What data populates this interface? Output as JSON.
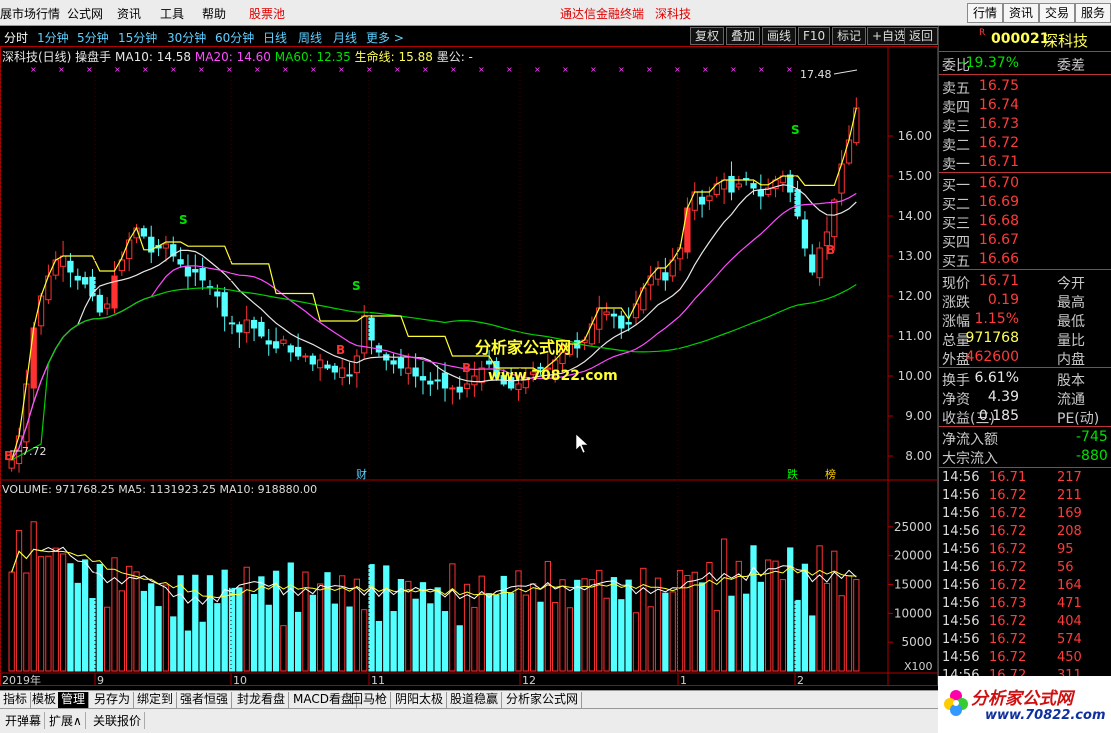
{
  "menu": {
    "items": [
      "展市场行情",
      "公式网",
      "资讯",
      "工具",
      "帮助"
    ],
    "stock_pool": "股票池",
    "title_center": "通达信金融终端",
    "title_stock": "深科技",
    "right_buttons": [
      "行情",
      "资讯",
      "交易",
      "服务"
    ]
  },
  "toolbar": {
    "timeframes": [
      "分时",
      "1分钟",
      "5分钟",
      "15分钟",
      "30分钟",
      "60分钟",
      "日线",
      "周线",
      "月线",
      "更多 >"
    ],
    "buttons": [
      "复权",
      "叠加",
      "画线",
      "F10",
      "标记",
      "+自选",
      "返回"
    ]
  },
  "legend": {
    "name": "深科技(日线) 操盘手",
    "ma10": "MA10: 14.58",
    "ma20": "MA20: 14.60",
    "ma60": "MA60: 12.35",
    "life": "生命线: 15.88",
    "extra": "墨公: -"
  },
  "volume_legend": {
    "vol": "VOLUME: 971768.25",
    "ma5": "MA5: 1131923.25",
    "ma10": "MA10: 918880.00"
  },
  "chart_data": {
    "type": "candlestick",
    "price_ticks": [
      "16.00",
      "15.00",
      "14.00",
      "13.00",
      "12.00",
      "11.00",
      "10.00",
      "9.00",
      "8.00"
    ],
    "volume_ticks": [
      "25000",
      "20000",
      "15000",
      "10000",
      "5000"
    ],
    "volume_unit": "X100",
    "x_labels": [
      "2019年",
      "9",
      "10",
      "11",
      "12",
      "1",
      "2"
    ],
    "annotations": {
      "high_label": "17.48",
      "low_label": "7.72",
      "watermark1": "分析家公式网",
      "watermark2": "www.70822.com",
      "marker_cai": "财",
      "marker_die": "跌",
      "marker_bang": "榜",
      "buy": "B",
      "sell": "S"
    },
    "ylim": [
      7.5,
      17.8
    ],
    "closes": [
      7.9,
      8.5,
      9.8,
      11.2,
      12.0,
      12.5,
      12.9,
      13.0,
      12.6,
      12.4,
      12.3,
      12.0,
      11.6,
      11.8,
      12.5,
      12.9,
      13.4,
      13.7,
      13.5,
      13.1,
      13.2,
      13.3,
      13.0,
      12.8,
      12.5,
      12.6,
      12.4,
      12.2,
      12.0,
      11.5,
      11.3,
      11.1,
      11.4,
      11.2,
      11.0,
      10.8,
      10.7,
      10.9,
      10.6,
      10.5,
      10.5,
      10.3,
      10.4,
      10.2,
      10.1,
      10.2,
      10.0,
      10.5,
      11.5,
      10.9,
      10.6,
      10.4,
      10.3,
      10.2,
      10.2,
      10.0,
      9.9,
      9.8,
      9.9,
      9.7,
      9.7,
      9.6,
      9.8,
      10.0,
      10.2,
      10.3,
      10.0,
      9.8,
      9.7,
      9.8,
      9.9,
      10.1,
      10.2,
      10.2,
      10.4,
      10.6,
      10.8,
      10.7,
      10.9,
      11.3,
      11.7,
      11.6,
      11.5,
      11.2,
      11.3,
      11.8,
      12.2,
      12.5,
      12.7,
      12.4,
      12.9,
      13.2,
      14.2,
      14.6,
      14.3,
      14.5,
      14.8,
      14.9,
      14.6,
      14.8,
      14.9,
      14.7,
      14.5,
      14.7,
      14.9,
      15.0,
      14.6,
      14.0,
      13.2,
      12.6,
      13.2,
      13.6,
      14.4,
      15.3,
      15.9,
      16.7
    ]
  },
  "quote": {
    "code": "000021",
    "name": "深科技",
    "weibi_label": "委比",
    "weibi": "-19.37%",
    "weicha_label": "委差",
    "sell": [
      {
        "label": "卖五",
        "price": "16.75"
      },
      {
        "label": "卖四",
        "price": "16.74"
      },
      {
        "label": "卖三",
        "price": "16.73"
      },
      {
        "label": "卖二",
        "price": "16.72"
      },
      {
        "label": "卖一",
        "price": "16.71"
      }
    ],
    "buy": [
      {
        "label": "买一",
        "price": "16.70"
      },
      {
        "label": "买二",
        "price": "16.69"
      },
      {
        "label": "买三",
        "price": "16.68"
      },
      {
        "label": "买四",
        "price": "16.67"
      },
      {
        "label": "买五",
        "price": "16.66"
      }
    ],
    "stats": [
      {
        "label": "现价",
        "value": "16.71",
        "label2": "今开",
        "color": "red"
      },
      {
        "label": "涨跌",
        "value": "0.19",
        "label2": "最高",
        "color": "red"
      },
      {
        "label": "涨幅",
        "value": "1.15%",
        "label2": "最低",
        "color": "red"
      },
      {
        "label": "总量",
        "value": "971768",
        "label2": "量比",
        "color": "yellow"
      },
      {
        "label": "外盘",
        "value": "462600",
        "label2": "内盘",
        "color": "red"
      }
    ],
    "stats2": [
      {
        "label": "换手",
        "value": "6.61%",
        "label2": "股本",
        "color": "white"
      },
      {
        "label": "净资",
        "value": "4.39",
        "label2": "流通",
        "color": "white"
      },
      {
        "label": "收益(三)",
        "value": "0.185",
        "label2": "PE(动)",
        "color": "white"
      }
    ],
    "flow": [
      {
        "label": "净流入额",
        "value": "-745"
      },
      {
        "label": "大宗流入",
        "value": "-880"
      }
    ],
    "ticks": [
      {
        "t": "14:56",
        "p": "16.71",
        "v": "217"
      },
      {
        "t": "14:56",
        "p": "16.72",
        "v": "211"
      },
      {
        "t": "14:56",
        "p": "16.72",
        "v": "169"
      },
      {
        "t": "14:56",
        "p": "16.72",
        "v": "208"
      },
      {
        "t": "14:56",
        "p": "16.72",
        "v": "95"
      },
      {
        "t": "14:56",
        "p": "16.72",
        "v": "56"
      },
      {
        "t": "14:56",
        "p": "16.72",
        "v": "164"
      },
      {
        "t": "14:56",
        "p": "16.73",
        "v": "471"
      },
      {
        "t": "14:56",
        "p": "16.72",
        "v": "404"
      },
      {
        "t": "14:56",
        "p": "16.72",
        "v": "574"
      },
      {
        "t": "14:56",
        "p": "16.72",
        "v": "450"
      },
      {
        "t": "14:56",
        "p": "16.72",
        "v": "311"
      }
    ]
  },
  "bottom_tabs": [
    "指标",
    "模板",
    "管理",
    "另存为",
    "绑定到",
    "强者恒强",
    "封龙看盘",
    "MACD看盘",
    "回马枪",
    "阴阳太极",
    "股道稳赢",
    "分析家公式网"
  ],
  "bottom_bar": [
    "开弹幕",
    "扩展∧",
    "关联报价"
  ],
  "logo": {
    "title": "分析家公式网",
    "url": "www.70822.com"
  }
}
